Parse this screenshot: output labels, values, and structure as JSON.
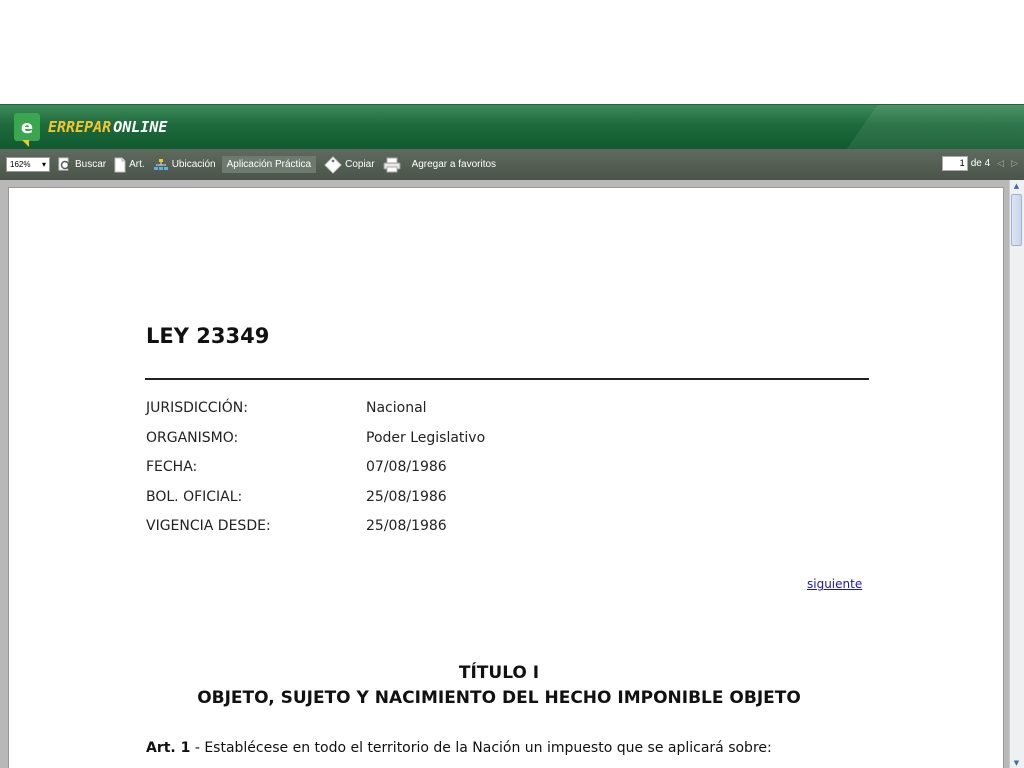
{
  "brand": {
    "logo_letter": "e",
    "name_part1": "ERREPAR",
    "name_part2": "ONLINE"
  },
  "toolbar": {
    "zoom_value": "162%",
    "buscar_label": "Buscar",
    "art_label": "Art.",
    "ubicacion_label": "Ubicación",
    "aplicacion_label": "Aplicación Práctica",
    "copiar_label": "Copiar",
    "favoritos_label": "Agregar a favoritos",
    "page_current": "1",
    "page_total_label": "de 4"
  },
  "document": {
    "title": "LEY 23349",
    "meta": [
      {
        "key": "JURISDICCIÓN:",
        "value": "Nacional"
      },
      {
        "key": "ORGANISMO:",
        "value": "Poder Legislativo"
      },
      {
        "key": "FECHA:",
        "value": "07/08/1986"
      },
      {
        "key": "BOL. OFICIAL:",
        "value": "25/08/1986"
      },
      {
        "key": "VIGENCIA DESDE:",
        "value": "25/08/1986"
      }
    ],
    "next_link": "siguiente",
    "titulo_1": "TÍTULO I",
    "titulo_2": "OBJETO, SUJETO Y NACIMIENTO DEL HECHO IMPONIBLE OBJETO",
    "article_label": "Art. 1",
    "article_text": " - Establécese en todo el territorio de la Nación un impuesto que se aplicará sobre:"
  },
  "colors": {
    "brand_green": "#1e6a3d",
    "brand_yellow": "#f2c531",
    "toolbar_gray": "#4a544a",
    "link_blue": "#1a1aa6"
  },
  "icons": [
    "search-icon",
    "document-icon",
    "sitemap-icon",
    "tag-icon",
    "printer-icon",
    "prev-page-icon",
    "next-page-icon"
  ]
}
